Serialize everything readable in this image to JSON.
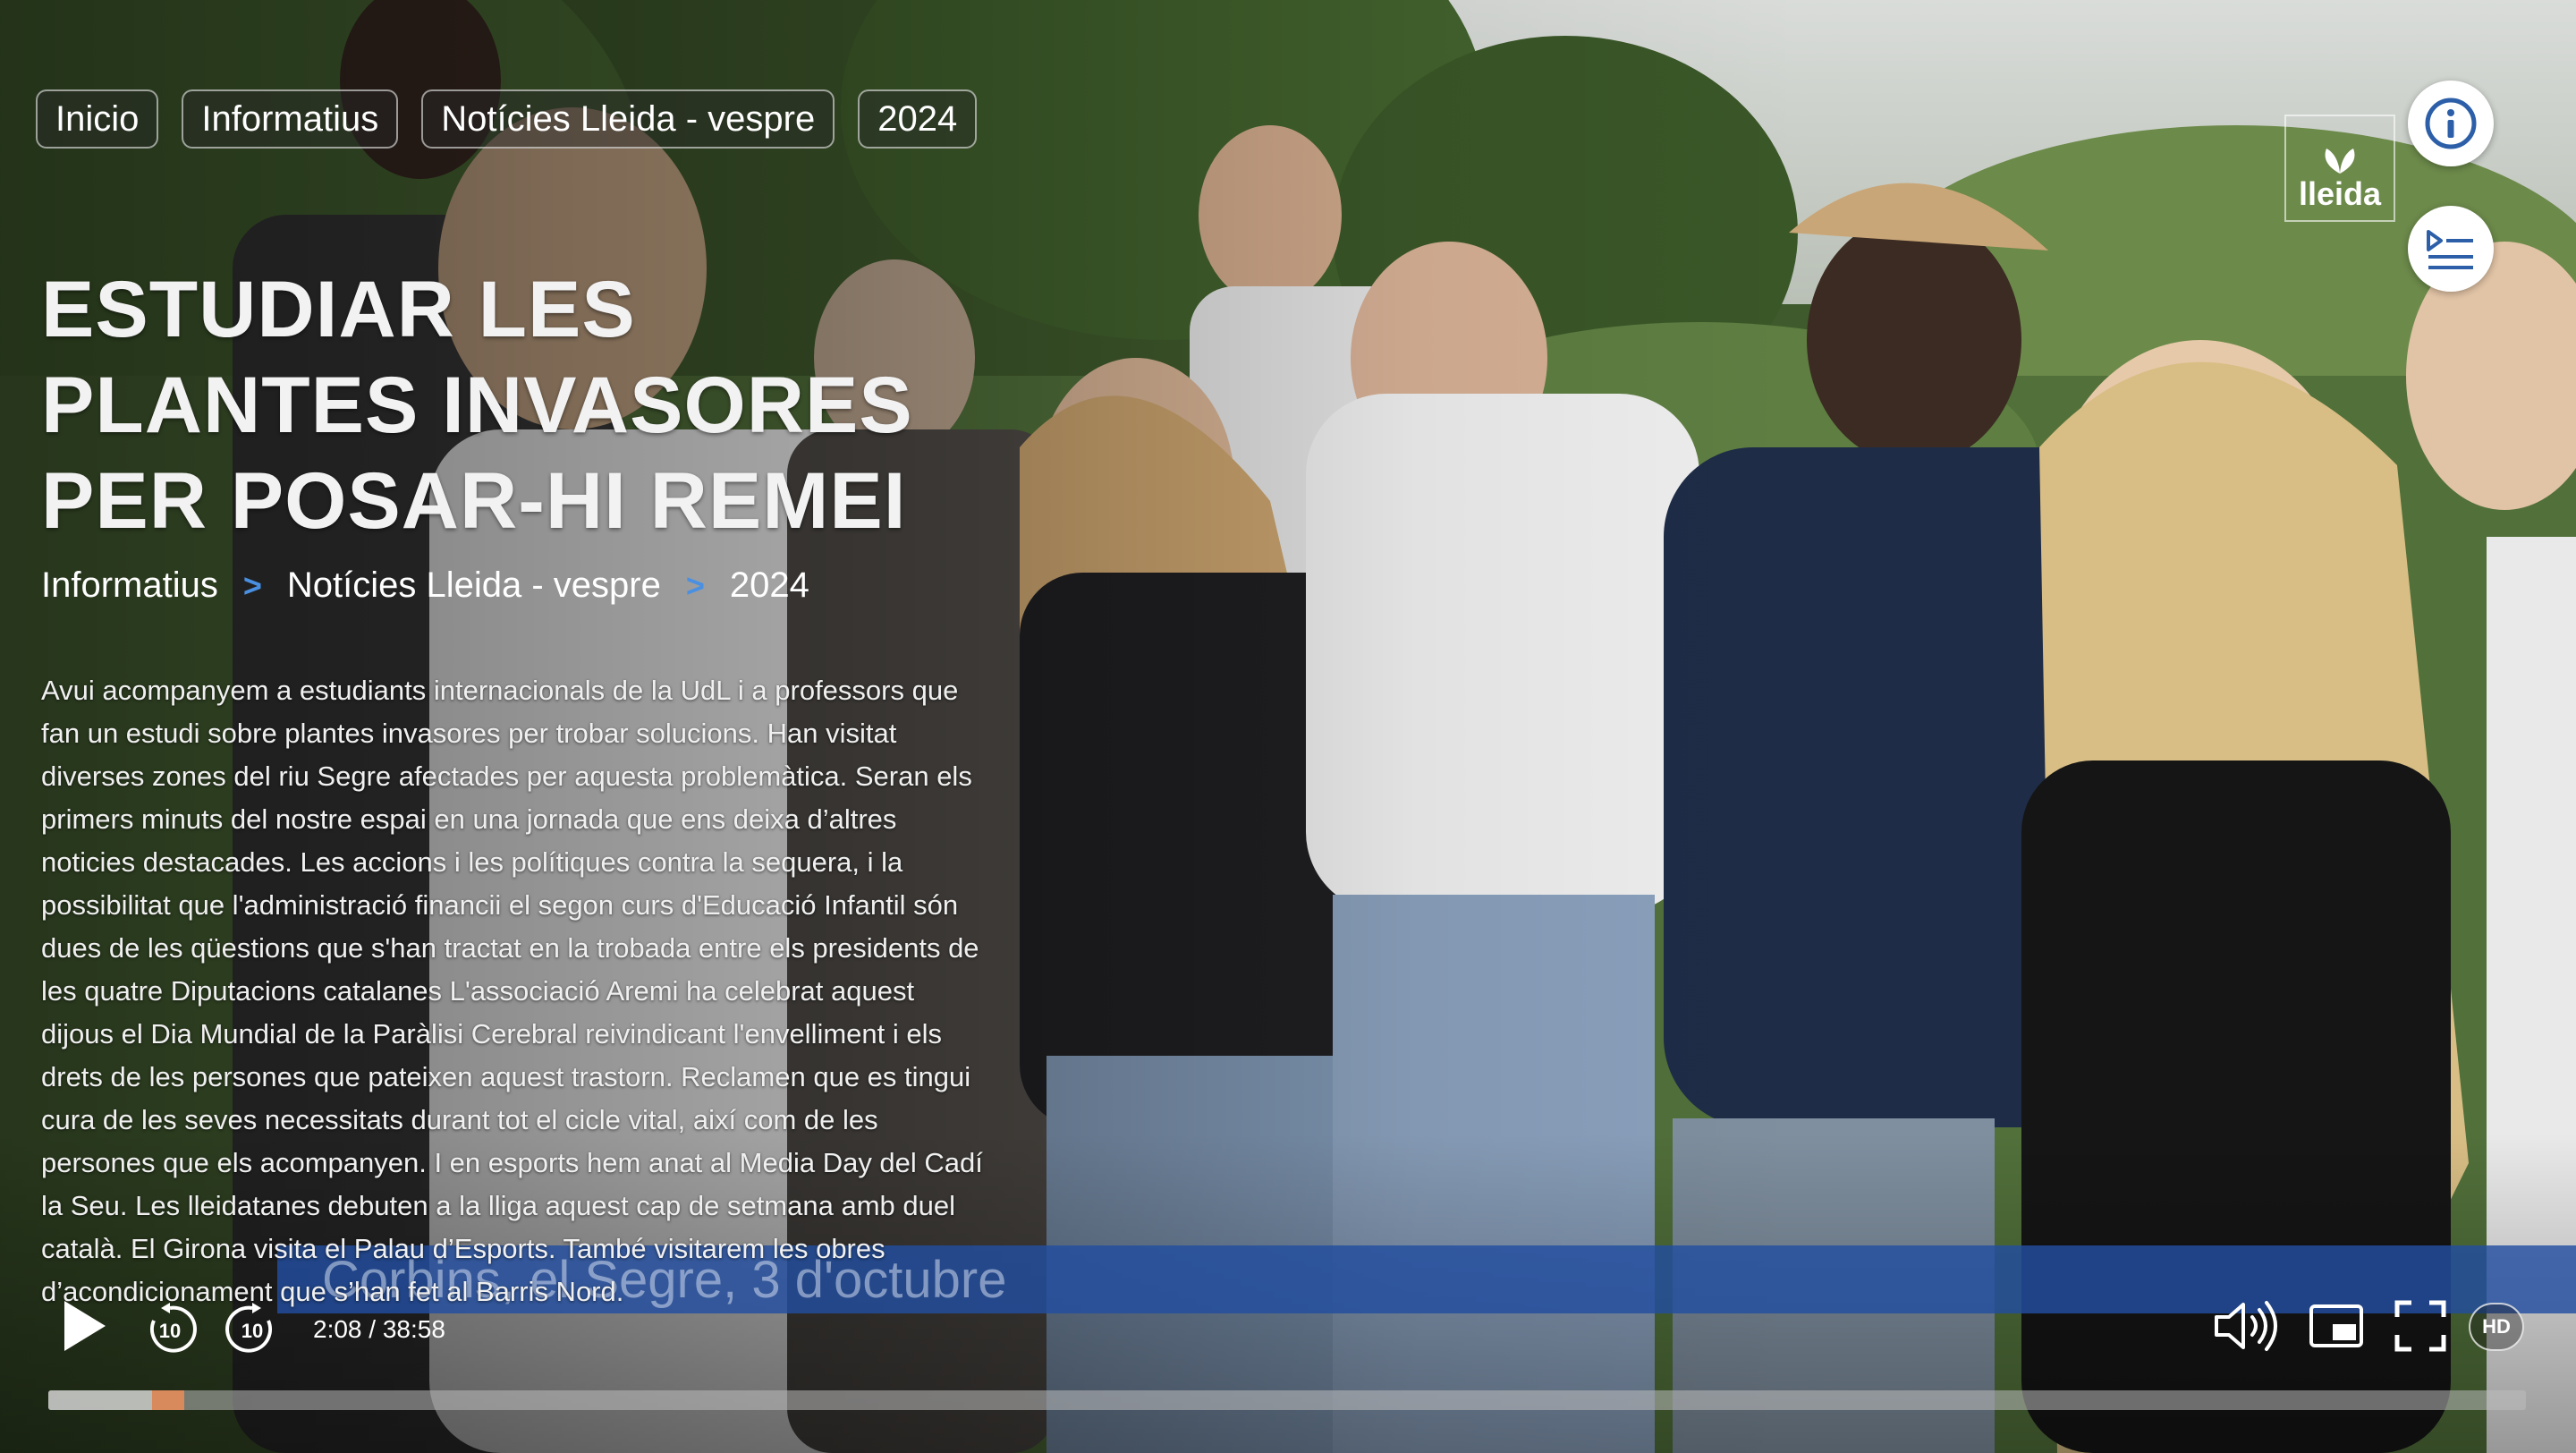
{
  "top_chips": [
    "Inicio",
    "Informatius",
    "Notícies Lleida - vespre",
    "2024"
  ],
  "title": "ESTUDIAR LES PLANTES INVASORES PER POSAR-HI REMEI",
  "breadcrumb": {
    "items": [
      "Informatius",
      "Notícies Lleida - vespre",
      "2024"
    ],
    "separator": ">"
  },
  "description": "Avui acompanyem a estudiants internacionals de la UdL i a professors que fan un estudi sobre plantes invasores per trobar solucions. Han visitat diverses zones del riu Segre afectades per aquesta problemàtica. Seran els primers minuts del nostre espai en una jornada que ens deixa d’altres noticies destacades. Les accions i les polítiques contra la sequera, i la possibilitat que l'administració financii el segon curs d'Educació Infantil són dues de les qüestions que s'han tractat en la trobada entre els presidents de les quatre Diputacions catalanes L'associació Aremi ha celebrat aquest dijous el Dia Mundial de la Paràlisi Cerebral reivindicant l'envelliment i els drets de les persones que pateixen aquest trastorn. Reclamen que es tingui cura de les seves necessitats durant tot el cicle vital, així com de les persones que els acompanyen. I en esports hem anat al Media Day del Cadí la Seu. Les lleidatanes debuten a la lliga aquest cap de setmana amb duel català. El Girona visita el Palau d’Esports. També visitarem les obres d’acondicionament que s’han fet al Barris Nord.",
  "logo_text": "lleida",
  "lower_third": "Corbins, el Segre, 3 d'octubre",
  "player": {
    "time_display": "2:08 / 38:58",
    "current_time": "2:08",
    "duration": "38:58",
    "played_fraction": 0.0547,
    "buffered_fraction": 0.042,
    "quality_label": "HD",
    "skip_back_seconds": "10",
    "skip_forward_seconds": "10"
  },
  "icons": {
    "info": "info-icon",
    "list": "playlist-icon",
    "play": "play-icon",
    "rewind": "rewind-10-icon",
    "forward": "forward-10-icon",
    "volume": "volume-icon",
    "pip": "picture-in-picture-icon",
    "fullscreen": "fullscreen-icon"
  },
  "colors": {
    "breadcrumb_separator": "#4a90e2",
    "info_icon": "#2c5fa8",
    "progress_played": "#d98a5c",
    "lower_third_bar": "#224ea0"
  }
}
